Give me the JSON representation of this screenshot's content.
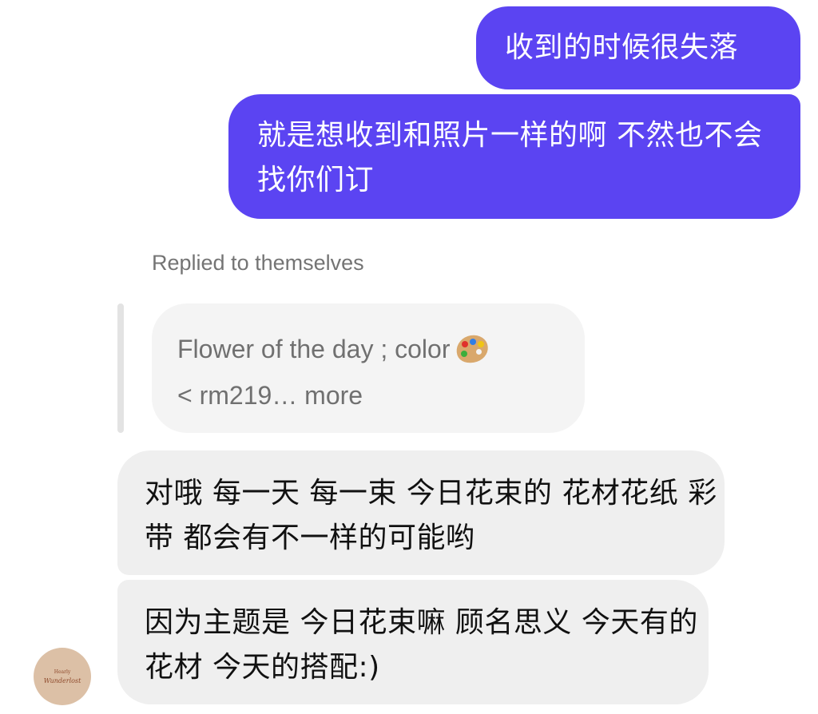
{
  "conversation": {
    "sent_messages": [
      {
        "text": "收到的时候很失落"
      },
      {
        "text": "就是想收到和照片一样的啊 不然也不会找你们订"
      }
    ],
    "reply_label": "Replied to themselves",
    "quoted_message": {
      "line1": "Flower of the day ; color",
      "line1_icon": "artist-palette-icon",
      "line2": "< rm219… more"
    },
    "received_messages": [
      {
        "text": "对哦 每一天 每一束 今日花束的 花材花纸 彩带 都会有不一样的可能哟"
      },
      {
        "text": "因为主题是 今日花束嘛 顾名思义 今天有的花材 今天的搭配:)"
      }
    ],
    "avatar": {
      "line1": "Hearly",
      "line2": "Wunderlost"
    }
  },
  "colors": {
    "sent_bubble": "#5b44f2",
    "received_bubble": "#efefef",
    "quoted_bubble": "#f4f4f4",
    "secondary_text": "#747474",
    "avatar_bg": "#dcc0a6"
  }
}
